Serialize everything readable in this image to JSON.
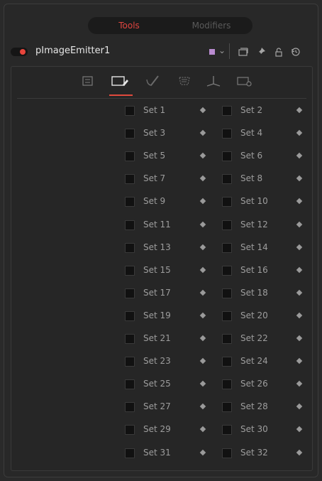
{
  "top_tabs": {
    "tools": "Tools",
    "modifiers": "Modifiers"
  },
  "header": {
    "tool_name": "pImageEmitter1",
    "swatch_color": "#b98bd0",
    "icons": [
      "chevron-down-icon",
      "window-icon",
      "pin-icon",
      "lock-icon",
      "reset-icon"
    ]
  },
  "panel_tabs": [
    {
      "name": "controls-tab-icon",
      "active": false
    },
    {
      "name": "style-tab-icon",
      "active": true
    },
    {
      "name": "paint-tab-icon",
      "active": false
    },
    {
      "name": "region-tab-icon",
      "active": false
    },
    {
      "name": "transform-tab-icon",
      "active": false
    },
    {
      "name": "settings-tab-icon",
      "active": false
    }
  ],
  "accent_color": "#e04a3d",
  "sets": [
    "Set 1",
    "Set 2",
    "Set 3",
    "Set 4",
    "Set 5",
    "Set 6",
    "Set 7",
    "Set 8",
    "Set 9",
    "Set 10",
    "Set 11",
    "Set 12",
    "Set 13",
    "Set 14",
    "Set 15",
    "Set 16",
    "Set 17",
    "Set 18",
    "Set 19",
    "Set 20",
    "Set 21",
    "Set 22",
    "Set 23",
    "Set 24",
    "Set 25",
    "Set 26",
    "Set 27",
    "Set 28",
    "Set 29",
    "Set 30",
    "Set 31",
    "Set 32"
  ]
}
